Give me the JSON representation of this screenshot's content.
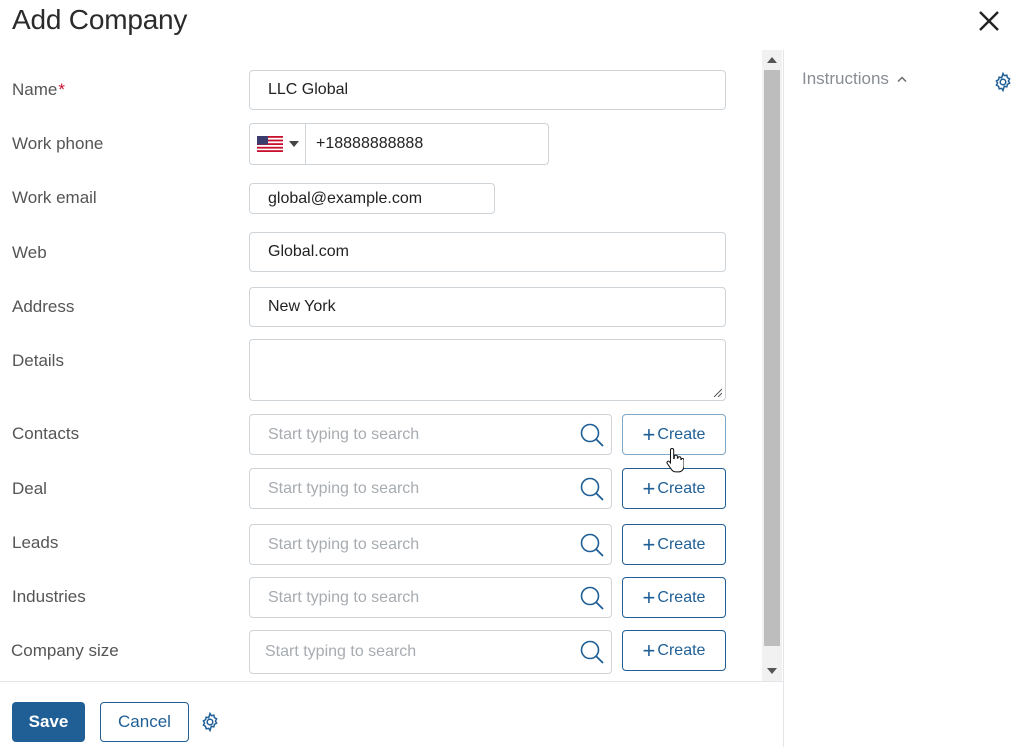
{
  "header": {
    "title": "Add Company",
    "close_icon": "close-icon"
  },
  "form": {
    "name": {
      "label": "Name",
      "required_mark": "*",
      "value": "LLC Global"
    },
    "work_phone": {
      "label": "Work phone",
      "country_flag": "us-flag-icon",
      "value": "+18888888888"
    },
    "work_email": {
      "label": "Work email",
      "value": "global@example.com"
    },
    "web": {
      "label": "Web",
      "value": "Global.com"
    },
    "address": {
      "label": "Address",
      "value": "New York"
    },
    "details": {
      "label": "Details",
      "value": ""
    },
    "contacts": {
      "label": "Contacts",
      "placeholder": "Start typing to search",
      "create_label": "Create"
    },
    "deal": {
      "label": "Deal",
      "placeholder": "Start typing to search",
      "create_label": "Create"
    },
    "leads": {
      "label": "Leads",
      "placeholder": "Start typing to search",
      "create_label": "Create"
    },
    "industries": {
      "label": "Industries",
      "placeholder": "Start typing to search",
      "create_label": "Create"
    },
    "company_size": {
      "label": "Company size",
      "placeholder": "Start typing to search",
      "create_label": "Create"
    }
  },
  "footer": {
    "save_label": "Save",
    "cancel_label": "Cancel"
  },
  "side_panel": {
    "instructions_label": "Instructions"
  },
  "colors": {
    "primary": "#1f5f95",
    "required": "#c8102e",
    "border": "#cfd4d9",
    "placeholder": "#a7acb1"
  }
}
